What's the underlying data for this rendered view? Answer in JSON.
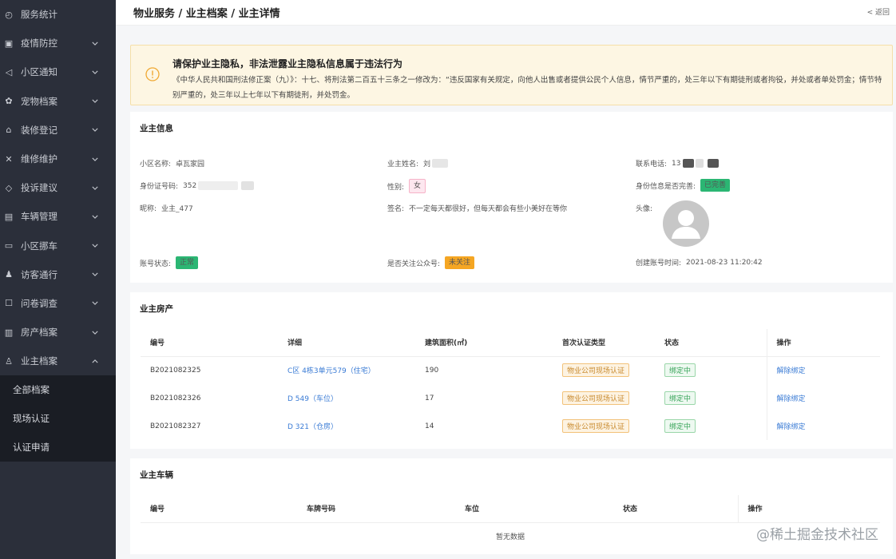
{
  "sidebar": {
    "items": [
      {
        "label": "服务统计",
        "icon": "dashboard-icon",
        "chevron": false
      },
      {
        "label": "疫情防控",
        "icon": "shield-icon",
        "chevron": true
      },
      {
        "label": "小区通知",
        "icon": "megaphone-icon",
        "chevron": true
      },
      {
        "label": "宠物档案",
        "icon": "pet-icon",
        "chevron": true
      },
      {
        "label": "装修登记",
        "icon": "house-icon",
        "chevron": true
      },
      {
        "label": "维修维护",
        "icon": "tools-icon",
        "chevron": true
      },
      {
        "label": "投诉建议",
        "icon": "feedback-icon",
        "chevron": true
      },
      {
        "label": "车辆管理",
        "icon": "car-icon",
        "chevron": true
      },
      {
        "label": "小区挪车",
        "icon": "car-move-icon",
        "chevron": true
      },
      {
        "label": "访客通行",
        "icon": "visitor-icon",
        "chevron": true
      },
      {
        "label": "问卷调查",
        "icon": "survey-icon",
        "chevron": true
      },
      {
        "label": "房产档案",
        "icon": "building-icon",
        "chevron": true
      },
      {
        "label": "业主档案",
        "icon": "user-icon",
        "chevron": true,
        "expanded": true
      }
    ],
    "submenu": [
      "全部档案",
      "现场认证",
      "认证申请"
    ]
  },
  "header": {
    "breadcrumb": "物业服务 / 业主档案 / 业主详情",
    "back": "< 返回"
  },
  "alert": {
    "title": "请保护业主隐私，非法泄露业主隐私信息属于违法行为",
    "body": "《中华人民共和国刑法修正案（九）》：十七、将刑法第二百五十三条之一修改为：“违反国家有关规定，向他人出售或者提供公民个人信息，情节严重的，处三年以下有期徒刑或者拘役，并处或者单处罚金；情节特别严重的，处三年以上七年以下有期徒刑，并处罚金。"
  },
  "owner_info": {
    "title": "业主信息",
    "community_label": "小区名称:",
    "community_value": "卓瓦家园",
    "name_label": "业主姓名:",
    "name_value": "刘",
    "phone_label": "联系电话:",
    "phone_value": "13",
    "id_label": "身份证号码:",
    "id_value": "352",
    "gender_label": "性别:",
    "gender_value": "女",
    "id_complete_label": "身份信息是否完善:",
    "id_complete_value": "已完善",
    "nickname_label": "昵称:",
    "nickname_value": "业主_477",
    "signature_label": "签名:",
    "signature_value": "不一定每天都很好，但每天都会有些小美好在等你",
    "avatar_label": "头像:",
    "status_label": "账号状态:",
    "status_value": "正常",
    "follow_label": "是否关注公众号:",
    "follow_value": "未关注",
    "created_label": "创建账号时间:",
    "created_value": "2021-08-23 11:20:42"
  },
  "property": {
    "title": "业主房产",
    "columns": [
      "编号",
      "详细",
      "建筑面积(㎡)",
      "首次认证类型",
      "状态",
      "操作"
    ],
    "rows": [
      {
        "id": "B2021082325",
        "detail": "C区 4栋3单元579（住宅）",
        "area": "190",
        "auth": "物业公司现场认证",
        "status": "绑定中",
        "action": "解除绑定"
      },
      {
        "id": "B2021082326",
        "detail": "D 549（车位）",
        "area": "17",
        "auth": "物业公司现场认证",
        "status": "绑定中",
        "action": "解除绑定"
      },
      {
        "id": "B2021082327",
        "detail": "D 321（仓房）",
        "area": "14",
        "auth": "物业公司现场认证",
        "status": "绑定中",
        "action": "解除绑定"
      }
    ]
  },
  "vehicles": {
    "title": "业主车辆",
    "columns": [
      "编号",
      "车牌号码",
      "车位",
      "状态",
      "操作"
    ],
    "empty": "暂无数据"
  },
  "footer_watermark": "@稀土掘金技术社区",
  "colors": {
    "sidebar": "#2b2f3a",
    "submenu": "#1a1d24",
    "green": "#2bb673",
    "orange": "#f5a623",
    "link": "#3a7bd5"
  }
}
